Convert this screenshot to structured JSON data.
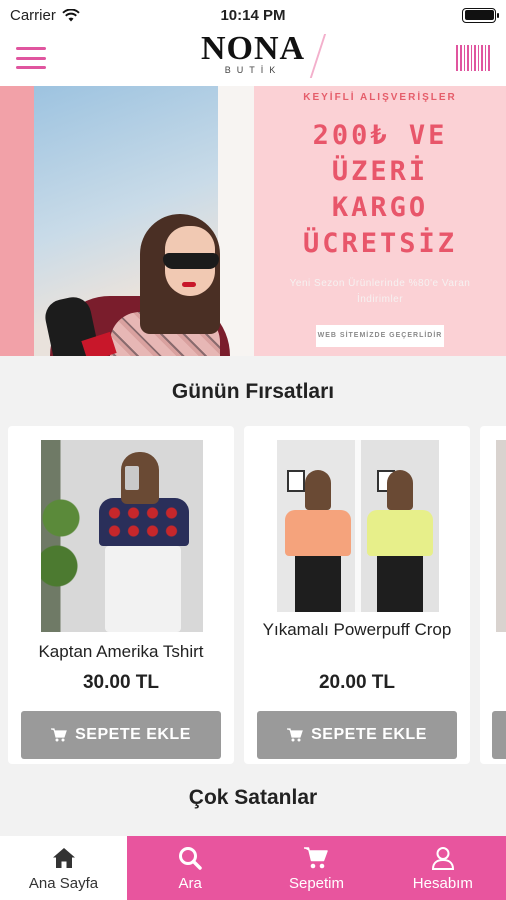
{
  "status_bar": {
    "carrier": "Carrier",
    "time": "10:14 PM"
  },
  "header": {
    "logo_title": "NONA",
    "logo_subtitle": "BUTİK"
  },
  "banner": {
    "eyebrow": "KEYİFLİ ALIŞVERİŞLER",
    "headline_lines": [
      "200₺ VE",
      "ÜZERİ",
      "KARGO",
      "ÜCRETSİZ"
    ],
    "subtext_line1": "Yeni Sezon Ürünlerinde %80'e Varan",
    "subtext_line2": "İndirimler",
    "tag": "WEB SİTEMİZDE GEÇERLİDİR"
  },
  "sections": {
    "deals_title": "Günün Fırsatları",
    "bestsellers_title": "Çok Satanlar"
  },
  "products": [
    {
      "name": "Kaptan Amerika Tshirt",
      "price": "30.00 TL",
      "button_label": "SEPETE EKLE"
    },
    {
      "name": "Yıkamalı Powerpuff Crop",
      "price": "20.00 TL",
      "button_label": "SEPETE EKLE"
    }
  ],
  "bottom_nav": {
    "items": [
      {
        "label": "Ana Sayfa",
        "icon": "home-icon",
        "active": true
      },
      {
        "label": "Ara",
        "icon": "search-icon",
        "active": false
      },
      {
        "label": "Sepetim",
        "icon": "cart-icon",
        "active": false
      },
      {
        "label": "Hesabım",
        "icon": "user-icon",
        "active": false
      }
    ]
  },
  "colors": {
    "brand_pink": "#e8559e",
    "promo_text": "#e8566a",
    "button_gray": "#9a9a9a"
  }
}
